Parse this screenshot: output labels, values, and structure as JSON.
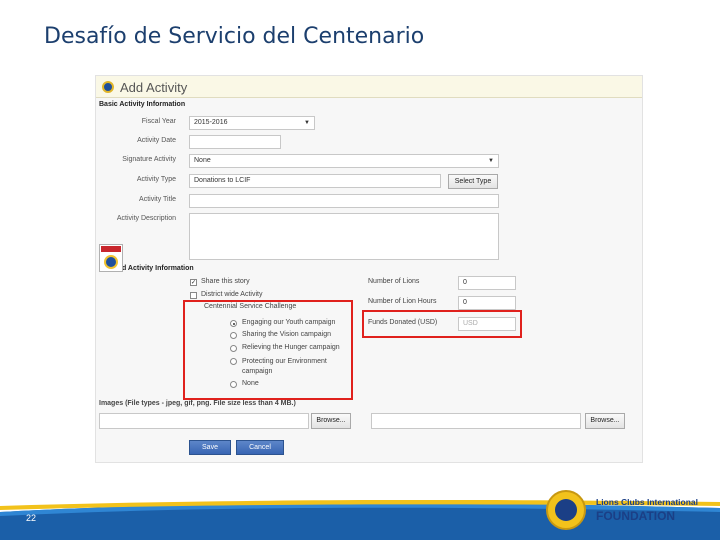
{
  "slide": {
    "title": "Desafío de Servicio del Centenario",
    "page_number": "22"
  },
  "form": {
    "header_title": "Add Activity",
    "basic_section": "Basic Activity Information",
    "fiscal_year": {
      "label": "Fiscal Year",
      "value": "2015-2016"
    },
    "activity_date": {
      "label": "Activity Date",
      "value": ""
    },
    "signature_activity": {
      "label": "Signature Activity",
      "value": "None"
    },
    "activity_type": {
      "label": "Activity Type",
      "value": "Donations to LCIF",
      "button": "Select Type"
    },
    "activity_title": {
      "label": "Activity Title",
      "value": ""
    },
    "activity_description": {
      "label": "Activity Description",
      "value": ""
    },
    "detailed_section": "Detailed Activity Information",
    "share_story": "Share this story",
    "district_wide": "District wide Activity",
    "challenge_title": "Centennial Service Challenge",
    "challenge_options": [
      "Engaging our Youth campaign",
      "Sharing the Vision campaign",
      "Relieving the Hunger campaign",
      "Protecting our Environment campaign",
      "None"
    ],
    "number_of_lions": {
      "label": "Number of Lions",
      "value": "0"
    },
    "number_of_lion_hours": {
      "label": "Number of Lion Hours",
      "value": "0"
    },
    "funds_donated": {
      "label": "Funds Donated (USD)",
      "placeholder": "USD"
    },
    "images_label": "Images (File types - jpeg, gif, png. File size less than 4 MB.)",
    "browse_label": "Browse...",
    "save_label": "Save",
    "cancel_label": "Cancel"
  },
  "footer": {
    "org_line1": "Lions Clubs International",
    "org_line2": "FOUNDATION",
    "badge_text": "CENTENNIAL"
  },
  "colors": {
    "title": "#1c3f6e",
    "highlight": "#e0211d",
    "save_button": "#3865b3",
    "footer_blue": "#1b5fa8",
    "footer_gold": "#f2c21b"
  }
}
